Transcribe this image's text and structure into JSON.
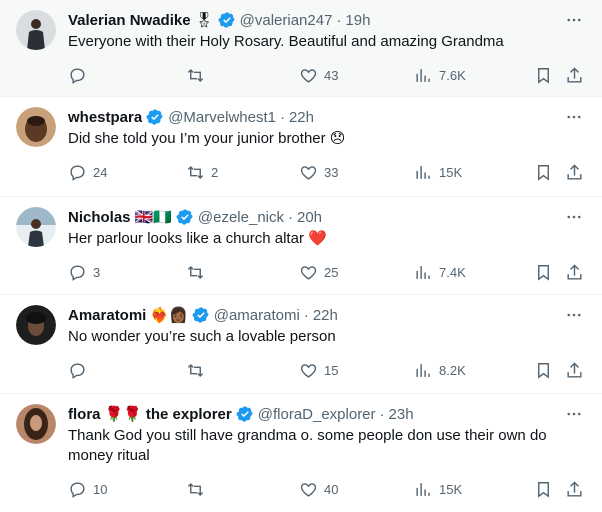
{
  "tweets": [
    {
      "name": "Valerian Nwadike",
      "name_emoji": "🎖",
      "handle": "@valerian247",
      "time": "19h",
      "text": "Everyone with their Holy Rosary. Beautiful and amazing Grandma",
      "replies": "",
      "retweets": "",
      "likes": "43",
      "views": "7.6K",
      "avatar_colors": [
        "#d9dde0",
        "#2b2f36"
      ]
    },
    {
      "name": "whestpara",
      "name_emoji": "",
      "handle": "@Marvelwhest1",
      "time": "22h",
      "text": "Did she told you I’m your junior brother 😞",
      "replies": "24",
      "retweets": "2",
      "likes": "33",
      "views": "15K",
      "avatar_colors": [
        "#5a3a22",
        "#c8a17a"
      ]
    },
    {
      "name": "Nicholas",
      "name_emoji": "🇬🇧🇳🇬",
      "handle": "@ezele_nick",
      "time": "20h",
      "text": "Her parlour looks like a church altar ❤️",
      "replies": "3",
      "retweets": "",
      "likes": "25",
      "views": "7.4K",
      "avatar_colors": [
        "#9fb8c9",
        "#e8eef2"
      ]
    },
    {
      "name": "Amaratomi",
      "name_emoji": "❤️‍🔥👩🏾",
      "handle": "@amaratomi",
      "time": "22h",
      "text": "No wonder you’re such a lovable person",
      "replies": "",
      "retweets": "",
      "likes": "15",
      "views": "8.2K",
      "avatar_colors": [
        "#1e1e1e",
        "#6b4b3a"
      ]
    },
    {
      "name": "flora",
      "name_emoji": "🌹🌹",
      "name_suffix": "the explorer",
      "handle": "@floraD_explorer",
      "time": "23h",
      "text": "Thank God you still have grandma o. some people don use their own do money ritual",
      "replies": "10",
      "retweets": "",
      "likes": "40",
      "views": "15K",
      "avatar_colors": [
        "#3a2418",
        "#b8876a"
      ]
    }
  ],
  "colors": {
    "verified": "#1d9bf0",
    "muted": "#536471",
    "text": "#0f1419"
  },
  "icons": [
    "reply-icon",
    "retweet-icon",
    "like-icon",
    "views-icon",
    "bookmark-icon",
    "share-icon",
    "more-icon",
    "verified-badge-icon"
  ]
}
